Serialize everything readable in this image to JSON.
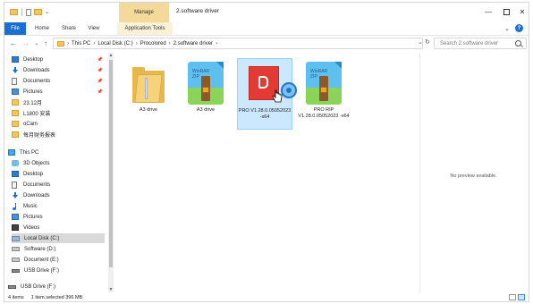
{
  "window": {
    "title": "2.software driver",
    "context_tab": "Manage",
    "controls": {
      "minimize": "—",
      "close": "✕"
    }
  },
  "ribbon": {
    "tabs": [
      "File",
      "Home",
      "Share",
      "View",
      "Application Tools"
    ],
    "collapse_glyph": "⌄",
    "help_glyph": "?"
  },
  "address": {
    "crumbs": [
      "This PC",
      "Local Disk (C:)",
      "Procolored",
      "2.software driver"
    ],
    "separator": "›",
    "dropdown_glyph": "⌄",
    "refresh_glyph": "↻"
  },
  "search": {
    "placeholder": "Search 2.software driver"
  },
  "nav": {
    "back_glyph": "←",
    "forward_glyph": "→",
    "recent_glyph": "⌄",
    "up_glyph": "↑"
  },
  "sidebar": {
    "pin_glyph": "📌",
    "quick_access": [
      {
        "label": "Desktop",
        "icon": "desktop-icon",
        "pinned": true
      },
      {
        "label": "Downloads",
        "icon": "downloads-icon",
        "pinned": true
      },
      {
        "label": "Documents",
        "icon": "documents-icon",
        "pinned": true
      },
      {
        "label": "Pictures",
        "icon": "pictures-icon",
        "pinned": true
      },
      {
        "label": "23.12月",
        "icon": "folder-icon"
      },
      {
        "label": "L1800 安装",
        "icon": "folder-icon"
      },
      {
        "label": "oCam",
        "icon": "folder-icon"
      },
      {
        "label": "每月财务报表",
        "icon": "folder-icon"
      }
    ],
    "this_pc": "This PC",
    "pc_items": [
      {
        "label": "3D Objects",
        "icon": "3d-objects-icon"
      },
      {
        "label": "Desktop",
        "icon": "desktop-icon"
      },
      {
        "label": "Documents",
        "icon": "documents-icon"
      },
      {
        "label": "Downloads",
        "icon": "downloads-icon"
      },
      {
        "label": "Music",
        "icon": "music-icon"
      },
      {
        "label": "Pictures",
        "icon": "pictures-icon"
      },
      {
        "label": "Videos",
        "icon": "videos-icon"
      },
      {
        "label": "Local Disk (C:)",
        "icon": "drive-c-icon",
        "selected": true
      },
      {
        "label": "Software (D:)",
        "icon": "drive-icon"
      },
      {
        "label": "Document (E:)",
        "icon": "drive-icon"
      },
      {
        "label": "USB Drive (F:)",
        "icon": "usb-drive-icon"
      }
    ],
    "usb_root": "USB Drive (F:)",
    "scroll_up": "▲",
    "scroll_down": "▼"
  },
  "files": [
    {
      "name": "A3 drive",
      "type": "folder",
      "icon": "folder-icon"
    },
    {
      "name": "A3 drive",
      "type": "zip",
      "icon": "winrar-archive-icon",
      "badge": "WinRAR\nZIP"
    },
    {
      "name": "PRO V1.28.0.05052023 -x64",
      "type": "app",
      "icon": "procolored-app-icon",
      "selected": true
    },
    {
      "name": "PRO RIP V1.28.0.05052023 -x64",
      "type": "zip",
      "icon": "winrar-archive-icon",
      "badge": "WinRAR\nZIP"
    }
  ],
  "preview": {
    "text": "No preview available."
  },
  "status": {
    "items_count": "4 items",
    "selection": "1 item selected  396 MB"
  },
  "colors": {
    "accent": "#1a6fd1",
    "manage_tab": "#f3d99a",
    "selection": "#cce8ff"
  }
}
